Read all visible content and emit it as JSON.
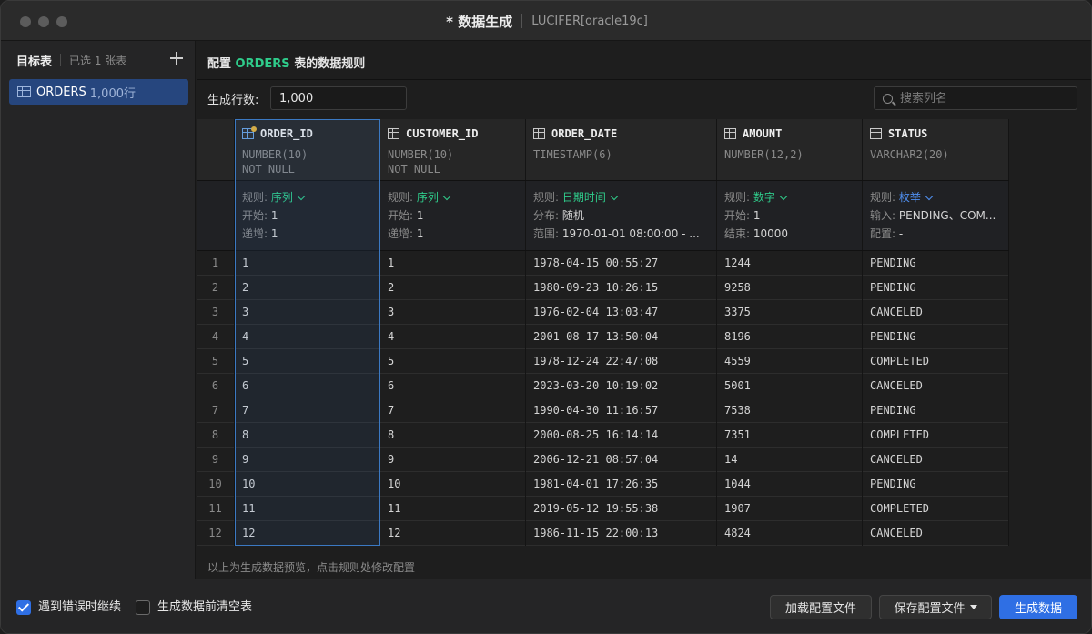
{
  "window": {
    "title": "* 数据生成",
    "connection": "LUCIFER[oracle19c]"
  },
  "sidebar": {
    "title": "目标表",
    "selected_count": "已选 1 张表",
    "items": [
      {
        "name": "ORDERS",
        "rows": "1,000行"
      }
    ]
  },
  "config": {
    "prefix": "配置",
    "table": "ORDERS",
    "suffix": "表的数据规则",
    "rows_label": "生成行数:",
    "rows_value": "1,000",
    "search_placeholder": "搜索列名"
  },
  "columns": [
    {
      "name": "ORDER_ID",
      "type": "NUMBER(10)",
      "constraint": "NOT NULL",
      "primary_key": true,
      "rule_label": "规则:",
      "rule": "序列",
      "rule_color": "green",
      "l2_label": "开始:",
      "l2_value": "1",
      "l3_label": "递增:",
      "l3_value": "1"
    },
    {
      "name": "CUSTOMER_ID",
      "type": "NUMBER(10)",
      "constraint": "NOT NULL",
      "primary_key": false,
      "rule_label": "规则:",
      "rule": "序列",
      "rule_color": "green",
      "l2_label": "开始:",
      "l2_value": "1",
      "l3_label": "递增:",
      "l3_value": "1"
    },
    {
      "name": "ORDER_DATE",
      "type": "TIMESTAMP(6)",
      "constraint": "",
      "primary_key": false,
      "rule_label": "规则:",
      "rule": "日期时间",
      "rule_color": "green",
      "l2_label": "分布:",
      "l2_value": "随机",
      "l3_label": "范围:",
      "l3_value": "1970-01-01 08:00:00 - ..."
    },
    {
      "name": "AMOUNT",
      "type": "NUMBER(12,2)",
      "constraint": "",
      "primary_key": false,
      "rule_label": "规则:",
      "rule": "数字",
      "rule_color": "green",
      "l2_label": "开始:",
      "l2_value": "1",
      "l3_label": "结束:",
      "l3_value": "10000"
    },
    {
      "name": "STATUS",
      "type": "VARCHAR2(20)",
      "constraint": "",
      "primary_key": false,
      "rule_label": "规则:",
      "rule": "枚举",
      "rule_color": "blue",
      "l2_label": "输入:",
      "l2_value": "PENDING、COM...",
      "l3_label": "配置:",
      "l3_value": "-"
    }
  ],
  "rows": [
    [
      "1",
      "1",
      "1",
      "1978-04-15 00:55:27",
      "1244",
      "PENDING"
    ],
    [
      "2",
      "2",
      "2",
      "1980-09-23 10:26:15",
      "9258",
      "PENDING"
    ],
    [
      "3",
      "3",
      "3",
      "1976-02-04 13:03:47",
      "3375",
      "CANCELED"
    ],
    [
      "4",
      "4",
      "4",
      "2001-08-17 13:50:04",
      "8196",
      "PENDING"
    ],
    [
      "5",
      "5",
      "5",
      "1978-12-24 22:47:08",
      "4559",
      "COMPLETED"
    ],
    [
      "6",
      "6",
      "6",
      "2023-03-20 10:19:02",
      "5001",
      "CANCELED"
    ],
    [
      "7",
      "7",
      "7",
      "1990-04-30 11:16:57",
      "7538",
      "PENDING"
    ],
    [
      "8",
      "8",
      "8",
      "2000-08-25 16:14:14",
      "7351",
      "COMPLETED"
    ],
    [
      "9",
      "9",
      "9",
      "2006-12-21 08:57:04",
      "14",
      "CANCELED"
    ],
    [
      "10",
      "10",
      "10",
      "1981-04-01 17:26:35",
      "1044",
      "PENDING"
    ],
    [
      "11",
      "11",
      "11",
      "2019-05-12 19:55:38",
      "1907",
      "COMPLETED"
    ],
    [
      "12",
      "12",
      "12",
      "1986-11-15 22:00:13",
      "4824",
      "CANCELED"
    ]
  ],
  "preview_note": "以上为生成数据预览，点击规则处修改配置",
  "footer": {
    "continue_on_error": {
      "label": "遇到错误时继续",
      "checked": true
    },
    "truncate_first": {
      "label": "生成数据前清空表",
      "checked": false
    },
    "load_config": "加载配置文件",
    "save_config": "保存配置文件",
    "generate": "生成数据"
  },
  "colors": {
    "accent_blue": "#2f6fe4",
    "rule_green": "#2fcc8b",
    "rule_blue": "#4f8ff0",
    "selected_item": "#26467e"
  }
}
